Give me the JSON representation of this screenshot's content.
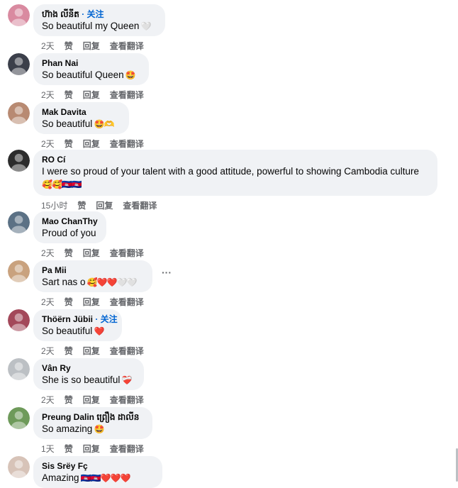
{
  "follow_label": "· 关注",
  "actions": {
    "like": "赞",
    "reply": "回复",
    "translate": "查看翻译"
  },
  "comments": [
    {
      "author": "ហ៊ាង លីនីត",
      "text": "So beautiful my Queen",
      "emoji": "🤍",
      "time": "2天",
      "follow": true,
      "avatar_color": "#d98aa0"
    },
    {
      "author": "Phan Nai",
      "text": "So beautiful Queen",
      "emoji": "🤩",
      "time": "2天",
      "follow": false,
      "avatar_color": "#3b3f4a"
    },
    {
      "author": "Mak Davita",
      "text": "So beautiful",
      "emoji": "🤩🫶",
      "time": "2天",
      "follow": false,
      "avatar_color": "#b88a72"
    },
    {
      "author": "RO Cí",
      "text": "I were so proud of your talent with a good attitude, powerful to showing Cambodia culture",
      "emoji": "🥰🥰🇰🇭🇰🇭",
      "time": "15小时",
      "follow": false,
      "avatar_color": "#2c2c2c"
    },
    {
      "author": "Mao ChanThy",
      "text": "Proud of you",
      "emoji": "",
      "time": "2天",
      "follow": false,
      "avatar_color": "#5b7185"
    },
    {
      "author": "Pa Mii",
      "text": "Sart nas o",
      "emoji": "🥰❤️❤️🤍🤍",
      "time": "2天",
      "follow": false,
      "avatar_color": "#c9a27e"
    },
    {
      "author": "Thöërn Jübii",
      "text": "So beautiful",
      "emoji": "❤️",
      "time": "2天",
      "follow": true,
      "avatar_color": "#a3485a"
    },
    {
      "author": "Vân Ry",
      "text": "She is so beautiful",
      "emoji": "❤️‍🩹",
      "time": "2天",
      "follow": false,
      "avatar_color": "#bcc0c4"
    },
    {
      "author": "Preung Dalin ព្រឿង ដាលីន",
      "text": "So amazing",
      "emoji": "🤩",
      "time": "1天",
      "follow": false,
      "avatar_color": "#6e9a5a"
    },
    {
      "author": "Sis Srëy Fç",
      "text": "Amazing",
      "emoji": "🇰🇭🇰🇭❤️❤️❤️",
      "time": "",
      "follow": false,
      "avatar_color": "#d7c3b8"
    }
  ]
}
